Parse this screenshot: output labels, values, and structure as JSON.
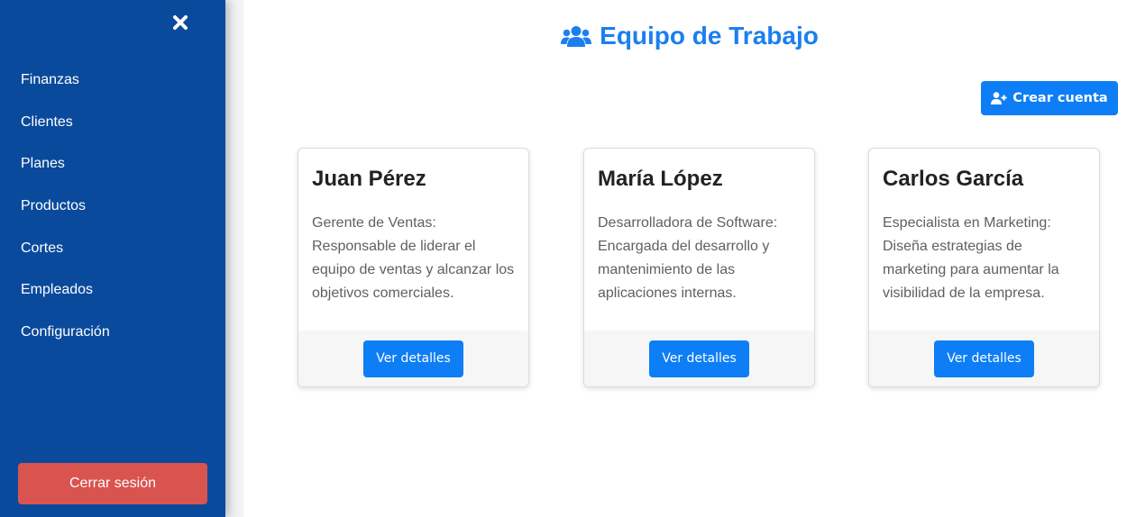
{
  "sidebar": {
    "close_icon": "close-icon",
    "items": [
      {
        "label": "Finanzas"
      },
      {
        "label": "Clientes"
      },
      {
        "label": "Planes"
      },
      {
        "label": "Productos"
      },
      {
        "label": "Cortes"
      },
      {
        "label": "Empleados"
      },
      {
        "label": "Configuración"
      }
    ],
    "logout_label": "Cerrar sesión",
    "background_color": "#0a4a9c",
    "logout_color": "#d9534f"
  },
  "header": {
    "title": "Equipo de Trabajo",
    "title_icon": "users-icon",
    "title_color": "#1b7ff0"
  },
  "actions": {
    "create_label": "Crear cuenta",
    "create_icon": "user-plus-icon",
    "accent_color": "#0d7ef5"
  },
  "cards": [
    {
      "name": "Juan Pérez",
      "description": "Gerente de Ventas: Responsable de liderar el equipo de ventas y alcanzar los objetivos comerciales.",
      "button_label": "Ver detalles"
    },
    {
      "name": "María López",
      "description": "Desarrolladora de Software: Encargada del desarrollo y mantenimiento de las aplicaciones internas.",
      "button_label": "Ver detalles"
    },
    {
      "name": "Carlos García",
      "description": "Especialista en Marketing: Diseña estrategias de marketing para aumentar la visibilidad de la empresa.",
      "button_label": "Ver detalles"
    }
  ]
}
